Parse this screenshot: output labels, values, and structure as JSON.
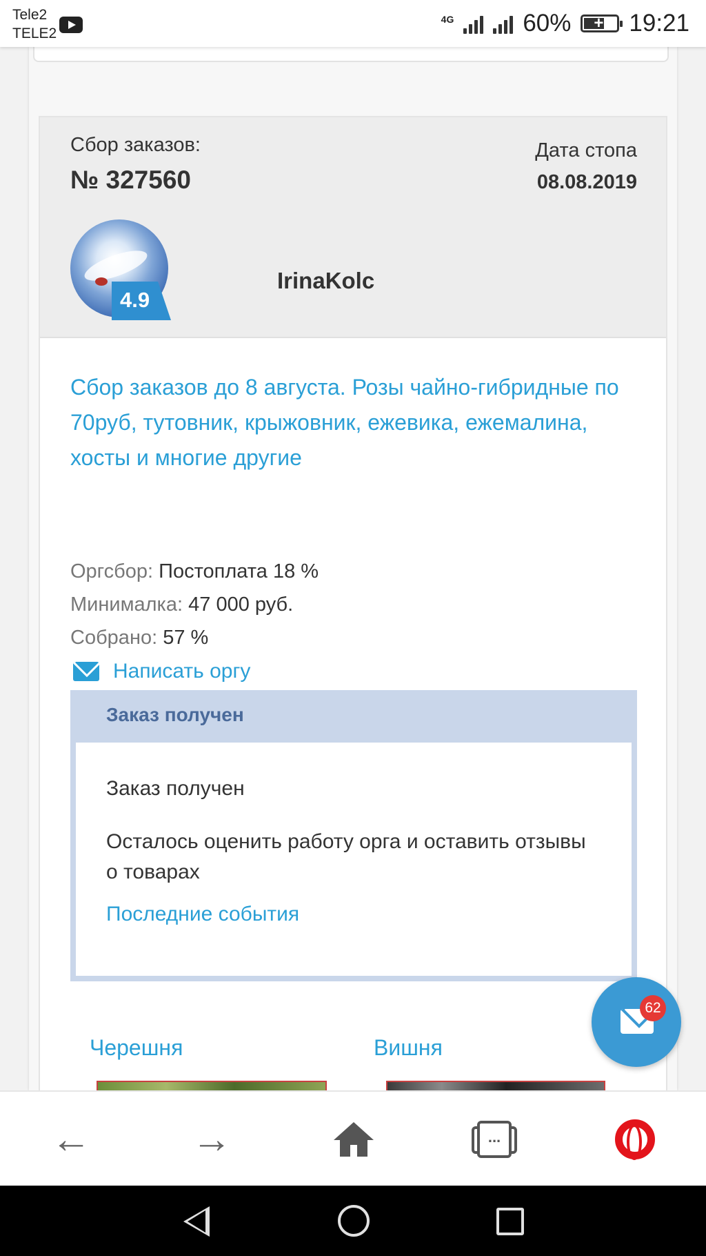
{
  "status_bar": {
    "carrier_top": "Tele2",
    "carrier_bottom": "TELE2",
    "network": "4G",
    "battery": "60%",
    "time": "19:21"
  },
  "order": {
    "label": "Сбор заказов:",
    "number": "№ 327560",
    "stop_label": "Дата стопа",
    "stop_date": "08.08.2019",
    "rating": "4.9",
    "organizer": "IrinaKolc",
    "title": "Сбор заказов до 8 августа. Розы чайно-гибридные по 70руб, тутовник, крыжовник, ежевика, ежемалина, хосты и многие другие",
    "fee_label": "Оргсбор:",
    "fee_value": "Постоплата 18 %",
    "min_label": "Минималка:",
    "min_value": "47 000 руб.",
    "collected_label": "Собрано:",
    "collected_value": "57 %",
    "write_link": "Написать оргу"
  },
  "status_box": {
    "header": "Заказ получен",
    "line1": "Заказ получен",
    "line2": "Осталось оценить работу орга и оставить отзывы о товарах",
    "link": "Последние события"
  },
  "categories": [
    {
      "label": "Черешня"
    },
    {
      "label": "Вишня"
    }
  ],
  "fab": {
    "badge": "62",
    "icon": "envelope-icon"
  },
  "toolbar": {
    "tabs_label": "..."
  },
  "colors": {
    "accent": "#2a9fd6",
    "status_header_bg": "#c9d6ea",
    "status_header_text": "#4a6a9a",
    "badge": "#e53935",
    "opera_red": "#e3141b"
  }
}
